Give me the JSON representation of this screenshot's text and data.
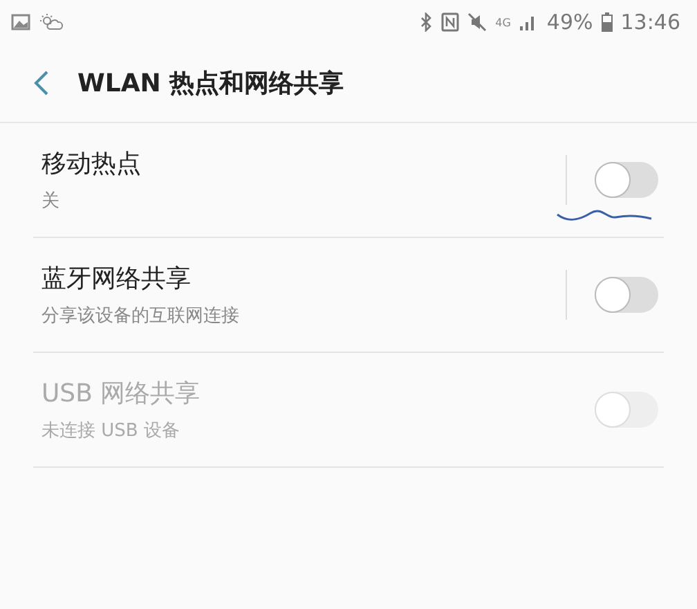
{
  "status_bar": {
    "network": "4G",
    "battery": "49%",
    "time": "13:46"
  },
  "header": {
    "title": "WLAN 热点和网络共享"
  },
  "settings": [
    {
      "title": "移动热点",
      "subtitle": "关",
      "on": false,
      "disabled": false,
      "divider": true
    },
    {
      "title": "蓝牙网络共享",
      "subtitle": "分享该设备的互联网连接",
      "on": false,
      "disabled": false,
      "divider": true
    },
    {
      "title": "USB 网络共享",
      "subtitle": "未连接 USB 设备",
      "on": false,
      "disabled": true,
      "divider": false
    }
  ]
}
